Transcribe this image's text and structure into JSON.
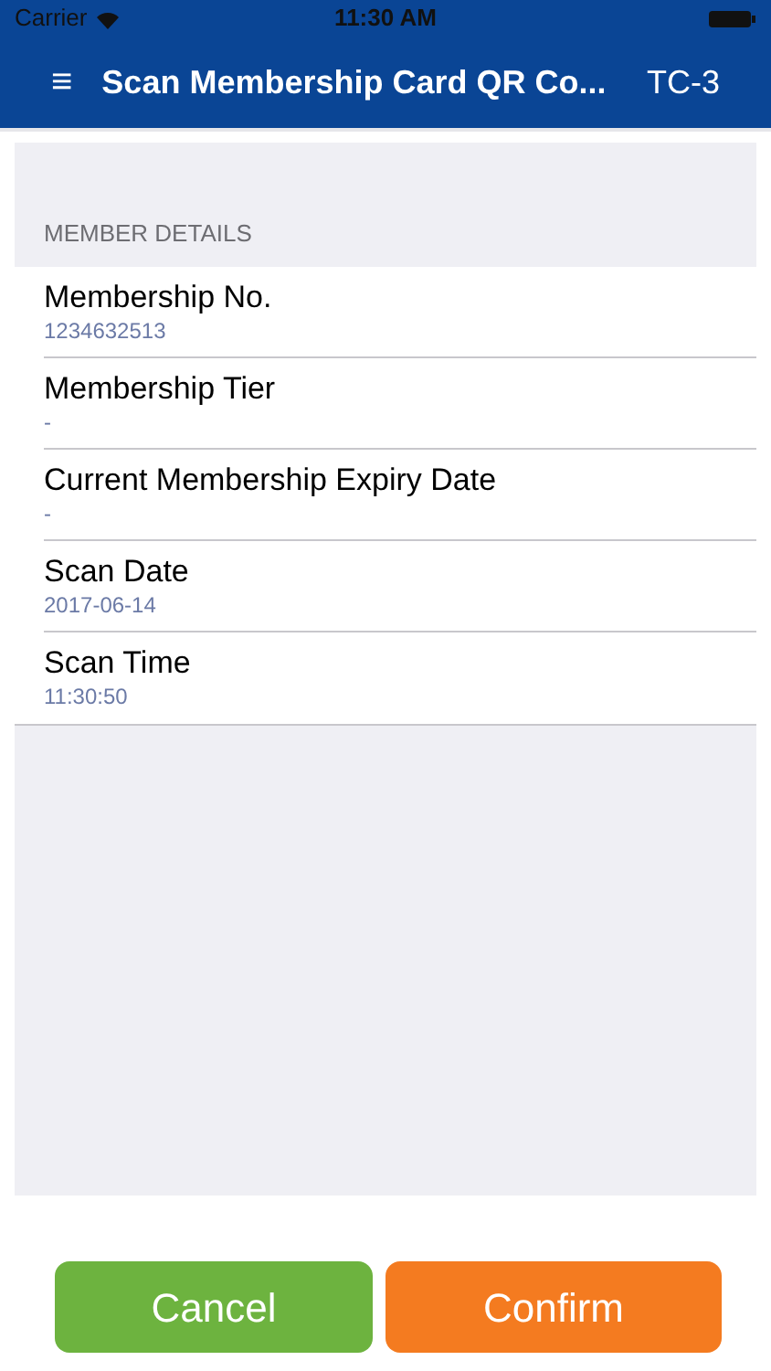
{
  "status_bar": {
    "carrier": "Carrier",
    "time": "11:30 AM"
  },
  "nav_bar": {
    "menu": "≡",
    "title": "Scan Membership Card QR Co...",
    "right": "TC-3"
  },
  "section": {
    "header": "MEMBER DETAILS",
    "rows": [
      {
        "label": "Membership No.",
        "value": "1234632513"
      },
      {
        "label": "Membership Tier",
        "value": "-"
      },
      {
        "label": "Current Membership Expiry Date",
        "value": "-"
      },
      {
        "label": "Scan Date",
        "value": "2017-06-14"
      },
      {
        "label": "Scan Time",
        "value": "11:30:50"
      }
    ]
  },
  "buttons": [
    {
      "label": "Cancel",
      "kind": "cancel"
    },
    {
      "label": "Confirm",
      "kind": "confirm"
    }
  ]
}
